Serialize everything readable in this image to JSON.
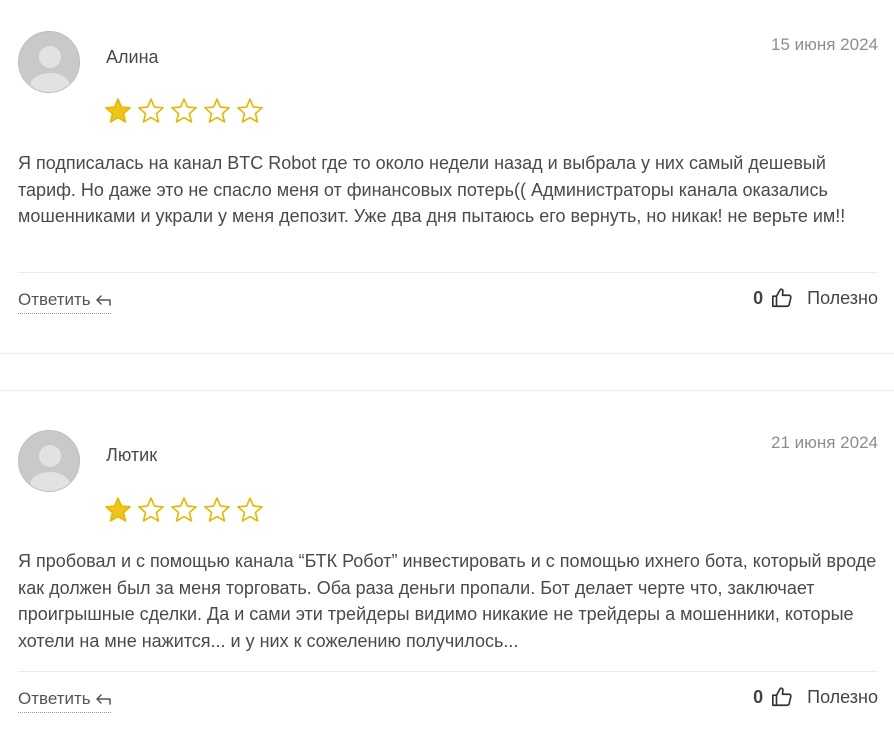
{
  "reviews": [
    {
      "author": "Алина",
      "date": "15 июня 2024",
      "rating": 1,
      "max_rating": 5,
      "text": "Я подписалась на канал BTC Robot где то около недели назад и выбрала у них самый дешевый тариф. Но даже это не спасло меня от финансовых потерь(( Администраторы канала оказались мошенниками и украли у меня депозит. Уже два дня пытаюсь его вернуть, но никак! не верьте им!!",
      "reply_label": "Ответить",
      "useful_count": "0",
      "useful_label": "Полезно"
    },
    {
      "author": "Лютик",
      "date": "21 июня 2024",
      "rating": 1,
      "max_rating": 5,
      "text": "Я пробовал и с помощью канала “БТК Робот” инвестировать и с помощью ихнего бота, который вроде как должен был за меня торговать. Оба раза деньги пропали. Бот делает черте что, заключает проигрышные сделки. Да и сами эти трейдеры видимо никакие не трейдеры а мошенники, которые хотели на мне нажится... и у них к сожелению получилось...",
      "reply_label": "Ответить",
      "useful_count": "0",
      "useful_label": "Полезно"
    }
  ],
  "colors": {
    "star_filled": "#f0c419",
    "star_outline": "#e6b800",
    "avatar_bg": "#c9c9c9",
    "date_text": "#8d8d8d"
  },
  "icons": {
    "avatar": "user-silhouette-icon",
    "star": "star-icon",
    "reply": "reply-arrow-icon",
    "useful": "thumbs-up-icon"
  }
}
